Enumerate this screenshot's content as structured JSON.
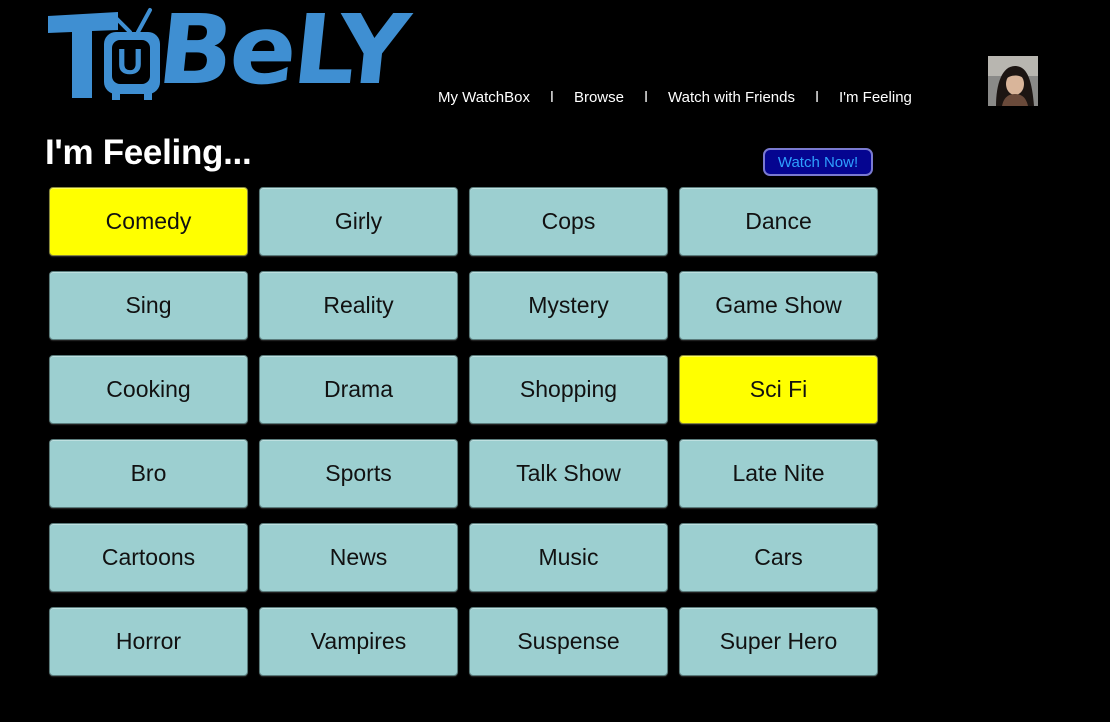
{
  "header": {
    "logo_text": "TuBeLY",
    "logo_letter": "U",
    "logo_color": "#3f8fd2"
  },
  "nav": {
    "items": [
      "My WatchBox",
      "Browse",
      "Watch with Friends",
      "I'm Feeling"
    ],
    "separator": "l"
  },
  "page": {
    "title": "I'm Feeling...",
    "watch_now_label": "Watch Now!"
  },
  "colors": {
    "background": "#000000",
    "tile": "#9ccfd0",
    "tile_selected": "#ffff00",
    "watch_button_bg": "#050590",
    "watch_button_text": "#2ea0ff"
  },
  "genres": [
    {
      "label": "Comedy",
      "selected": true
    },
    {
      "label": "Girly",
      "selected": false
    },
    {
      "label": "Cops",
      "selected": false
    },
    {
      "label": "Dance",
      "selected": false
    },
    {
      "label": "Sing",
      "selected": false
    },
    {
      "label": "Reality",
      "selected": false
    },
    {
      "label": "Mystery",
      "selected": false
    },
    {
      "label": "Game Show",
      "selected": false
    },
    {
      "label": "Cooking",
      "selected": false
    },
    {
      "label": "Drama",
      "selected": false
    },
    {
      "label": "Shopping",
      "selected": false
    },
    {
      "label": "Sci Fi",
      "selected": true
    },
    {
      "label": "Bro",
      "selected": false
    },
    {
      "label": "Sports",
      "selected": false
    },
    {
      "label": "Talk Show",
      "selected": false
    },
    {
      "label": "Late Nite",
      "selected": false
    },
    {
      "label": "Cartoons",
      "selected": false
    },
    {
      "label": "News",
      "selected": false
    },
    {
      "label": "Music",
      "selected": false
    },
    {
      "label": "Cars",
      "selected": false
    },
    {
      "label": "Horror",
      "selected": false
    },
    {
      "label": "Vampires",
      "selected": false
    },
    {
      "label": "Suspense",
      "selected": false
    },
    {
      "label": "Super Hero",
      "selected": false
    }
  ]
}
